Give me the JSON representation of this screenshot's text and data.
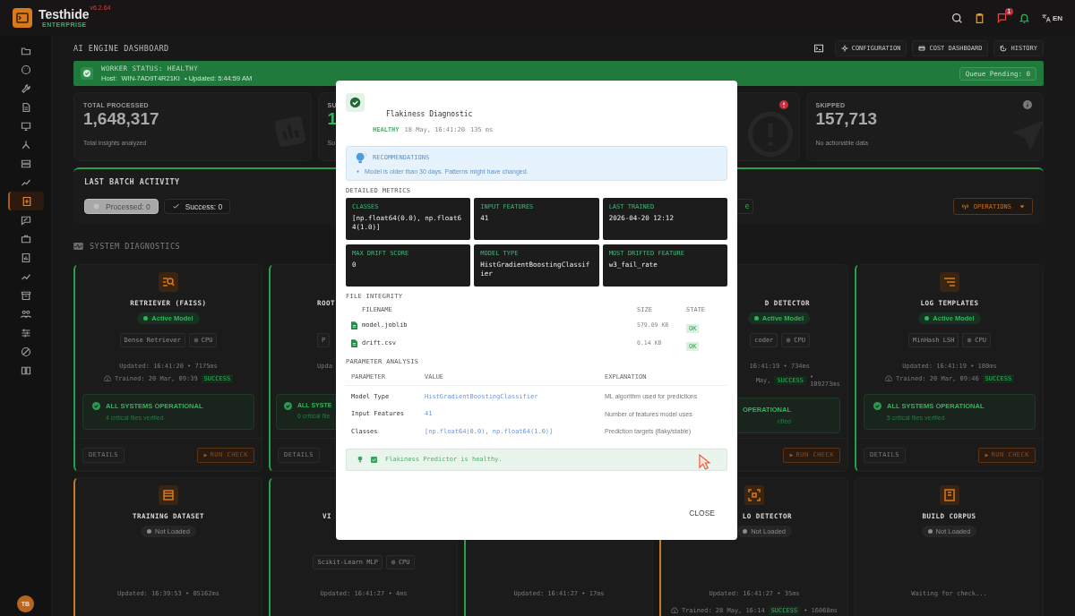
{
  "header": {
    "brand": "Testhide",
    "edition": "ENTERPRISE",
    "version": "v6.2.64",
    "notification_count": "1",
    "language": "EN"
  },
  "sidebar": {
    "items": [
      {
        "selected": false
      },
      {
        "selected": false
      },
      {
        "selected": false
      },
      {
        "selected": false
      },
      {
        "selected": false
      },
      {
        "selected": false
      },
      {
        "selected": false
      },
      {
        "selected": false
      },
      {
        "selected": true
      },
      {
        "selected": false
      },
      {
        "selected": false
      },
      {
        "selected": false
      },
      {
        "selected": false
      },
      {
        "selected": false
      },
      {
        "selected": false
      },
      {
        "selected": false
      },
      {
        "selected": false
      },
      {
        "selected": false
      }
    ],
    "avatar": "TB"
  },
  "page": {
    "title": "AI ENGINE DASHBOARD",
    "actions": [
      "CONFIGURATION",
      "COST DASHBOARD",
      "HISTORY"
    ]
  },
  "worker_status": {
    "title": "WORKER STATUS: HEALTHY",
    "host_label": "Host:",
    "host": "WIN-7AD9T4R21KI",
    "updated": "• Updated: 5:44:59 AM",
    "queue": "Queue Pending: 0"
  },
  "stats": [
    {
      "kind": "total",
      "label": "TOTAL PROCESSED",
      "value": "1,648,317",
      "caption": "Total insights analyzed"
    },
    {
      "kind": "success",
      "label": "SU",
      "value": "1",
      "caption": "Su"
    },
    {
      "kind": "failed"
    },
    {
      "kind": "skipped",
      "label": "SKIPPED",
      "value": "157,713",
      "caption": "No actionable data"
    }
  ],
  "batch": {
    "title": "LAST BATCH ACTIVITY",
    "filters": [
      {
        "kind": "processed",
        "label": "Processed: 0",
        "selected": true
      },
      {
        "kind": "success",
        "label": "Success: 0",
        "selected": false
      }
    ],
    "chip_3": "e",
    "operations": "OPERATIONS"
  },
  "diagnostics": {
    "title": "SYSTEM DIAGNOSTICS",
    "cards": [
      {
        "kind": "healthy",
        "title": "RETRIEVER (FAISS)",
        "status": {
          "label": "Active Model",
          "active": true
        },
        "chips": [
          {
            "kind": "model",
            "label": "Dense Retriever"
          },
          {
            "kind": "device",
            "label": "CPU"
          }
        ],
        "updated": "Updated: 16:41:20 • 7175ms",
        "trained": "Trained: 20 Mar, 09:39",
        "result": "SUCCESS",
        "check": {
          "title": "ALL SYSTEMS OPERATIONAL",
          "caption": "4 critical files verified"
        },
        "actions": [
          {
            "kind": "details",
            "label": "DETAILS"
          },
          {
            "kind": "run",
            "label": "RUN CHECK"
          }
        ]
      },
      {
        "kind": "healthy",
        "title": "ROOT",
        "chips": [
          {
            "kind": "model",
            "label": "P"
          }
        ],
        "updated": "Upda",
        "check": {
          "title": "ALL SYSTE",
          "caption": "6 critical file"
        },
        "actions": [
          {
            "kind": "details",
            "label": "DETAILS"
          }
        ]
      },
      {
        "kind": "healthy",
        "title": "D DETECTOR",
        "status": {
          "label": "Active Model",
          "active": true
        },
        "chips": [
          {
            "kind": "model",
            "label": "coder"
          },
          {
            "kind": "device",
            "label": "CPU"
          }
        ],
        "updated": "16:41:19 • 734ms",
        "trained": "May,",
        "result": "SUCCESS",
        "duration": "• 109273ms",
        "check": {
          "title": "OPERATIONAL",
          "caption": "rified"
        },
        "actions": [
          {
            "kind": "run",
            "label": "RUN CHECK"
          }
        ]
      },
      {
        "kind": "healthy",
        "title": "LOG TEMPLATES",
        "status": {
          "label": "Active Model",
          "active": true
        },
        "chips": [
          {
            "kind": "model",
            "label": "MinHash LSH"
          },
          {
            "kind": "device",
            "label": "CPU"
          }
        ],
        "updated": "Updated: 16:41:19 • 180ms",
        "trained": "Trained: 20 Mar, 09:46",
        "result": "SUCCESS",
        "check": {
          "title": "ALL SYSTEMS OPERATIONAL",
          "caption": "5 critical files verified"
        },
        "actions": [
          {
            "kind": "details",
            "label": "DETAILS"
          },
          {
            "kind": "run",
            "label": "RUN CHECK"
          }
        ]
      },
      {
        "kind": "warning",
        "title": "TRAINING DATASET",
        "status": {
          "label": "Not Loaded",
          "active": false
        },
        "updated": "Updated: 16:39:53 • 85162ms"
      },
      {
        "kind": "healthy",
        "title": "VI",
        "chips": [
          {
            "kind": "model",
            "label": "Scikit-Learn MLP"
          },
          {
            "kind": "device",
            "label": "CPU"
          }
        ],
        "updated": "Updated: 16:41:27 • 4ms"
      },
      {
        "kind": "healthy",
        "updated": "Updated: 16:41:27 • 17ms"
      },
      {
        "kind": "warning",
        "title": "LO DETECTOR",
        "status": {
          "label": "Not Loaded",
          "active": false
        },
        "updated": "Updated: 16:41:27 • 35ms",
        "trained": "Trained: 28 May, 16:14",
        "result": "SUCCESS",
        "duration": "• 16068ms"
      },
      {
        "kind": "pending",
        "title": "BUILD CORPUS",
        "status": {
          "label": "Not Loaded",
          "active": false
        },
        "updated": "Waiting for check..."
      }
    ]
  },
  "modal": {
    "title": "Flakiness Diagnostic",
    "status": "HEALTHY",
    "timestamp": "18 May, 16:41:20",
    "duration": "135 ms",
    "recommendations": {
      "title": "RECOMMENDATIONS",
      "items": [
        "Model is older than 30 days. Patterns might have changed."
      ]
    },
    "metrics_title": "DETAILED METRICS",
    "metrics": [
      {
        "label": "CLASSES",
        "value": "[np.float64(0.0), np.float64(1.0)]"
      },
      {
        "label": "INPUT FEATURES",
        "value": "41"
      },
      {
        "label": "LAST TRAINED",
        "value": "2026-04-20 12:12"
      },
      {
        "label": "MAX DRIFT SCORE",
        "value": "0"
      },
      {
        "label": "MODEL TYPE",
        "value": "HistGradientBoostingClassifier"
      },
      {
        "label": "MOST DRIFTED FEATURE",
        "value": "w3_fail_rate"
      }
    ],
    "files_title": "FILE INTEGRITY",
    "file_columns": [
      "FILENAME",
      "SIZE",
      "STATE"
    ],
    "files": [
      {
        "name": "model.joblib",
        "size": "579.09 KB",
        "state": "OK"
      },
      {
        "name": "drift.csv",
        "size": "0.14 KB",
        "state": "OK"
      }
    ],
    "params_title": "PARAMETER ANALYSIS",
    "param_columns": [
      "PARAMETER",
      "VALUE",
      "EXPLANATION"
    ],
    "params": [
      {
        "name": "Model Type",
        "value": "HistGradientBoostingClassifier",
        "explanation": "ML algorithm used for predictions"
      },
      {
        "name": "Input Features",
        "value": "41",
        "explanation": "Number of features model uses"
      },
      {
        "name": "Classes",
        "value": "[np.float64(0.0), np.float64(1.0)]",
        "explanation": "Prediction targets (flaky/stable)"
      }
    ],
    "verdict": "Flakiness Predictor is healthy.",
    "close": "CLOSE"
  }
}
